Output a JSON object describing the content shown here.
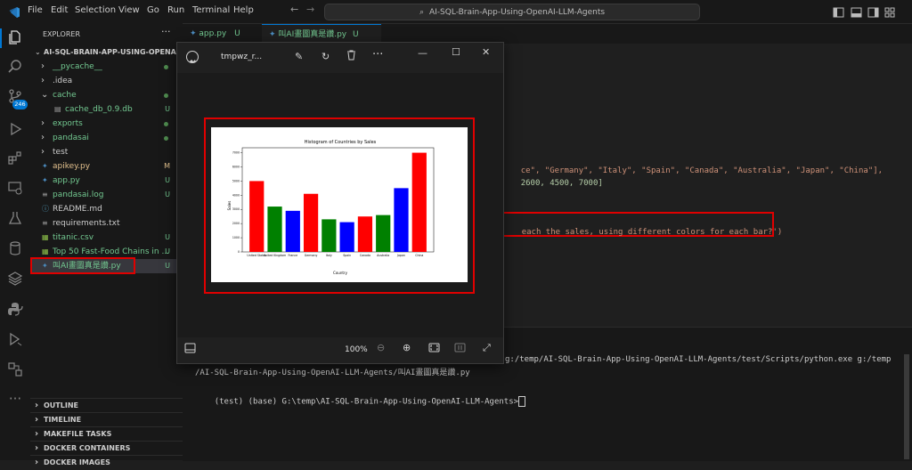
{
  "menu": [
    "File",
    "Edit",
    "Selection",
    "View",
    "Go",
    "Run",
    "Terminal",
    "Help"
  ],
  "command_center": "AI-SQL-Brain-App-Using-OpenAI-LLM-Agents",
  "activity_badge": "246",
  "explorer": {
    "header": "EXPLORER",
    "root": "AI-SQL-BRAIN-APP-USING-OPENAI-LL...",
    "items": [
      {
        "label": "__pycache__",
        "kind": "folder",
        "open": false,
        "indent": 1,
        "color": "#73c991",
        "status": "",
        "dot": true
      },
      {
        "label": ".idea",
        "kind": "folder",
        "open": false,
        "indent": 1,
        "color": "#cccccc",
        "status": "",
        "dot": false
      },
      {
        "label": "cache",
        "kind": "folder",
        "open": true,
        "indent": 1,
        "color": "#73c991",
        "status": "",
        "dot": true
      },
      {
        "label": "cache_db_0.9.db",
        "kind": "file",
        "indent": 2,
        "color": "#73c991",
        "status": "U",
        "dot": false
      },
      {
        "label": "exports",
        "kind": "folder",
        "open": false,
        "indent": 1,
        "color": "#73c991",
        "status": "",
        "dot": true
      },
      {
        "label": "pandasai",
        "kind": "folder",
        "open": false,
        "indent": 1,
        "color": "#73c991",
        "status": "",
        "dot": true
      },
      {
        "label": "test",
        "kind": "folder",
        "open": false,
        "indent": 1,
        "color": "#cccccc",
        "status": "",
        "dot": false
      },
      {
        "label": "apikey.py",
        "kind": "py",
        "indent": 1,
        "color": "#e2c08d",
        "status": "M",
        "dot": false
      },
      {
        "label": "app.py",
        "kind": "py",
        "indent": 1,
        "color": "#73c991",
        "status": "U",
        "dot": false
      },
      {
        "label": "pandasai.log",
        "kind": "log",
        "indent": 1,
        "color": "#73c991",
        "status": "U",
        "dot": false
      },
      {
        "label": "README.md",
        "kind": "md",
        "indent": 1,
        "color": "#cccccc",
        "status": "",
        "dot": false
      },
      {
        "label": "requirements.txt",
        "kind": "txt",
        "indent": 1,
        "color": "#cccccc",
        "status": "",
        "dot": false
      },
      {
        "label": "titanic.csv",
        "kind": "csv",
        "indent": 1,
        "color": "#73c991",
        "status": "U",
        "dot": false
      },
      {
        "label": "Top 50 Fast-Food Chains in ...",
        "kind": "csv",
        "indent": 1,
        "color": "#73c991",
        "status": "U",
        "dot": false
      },
      {
        "label": "叫AI畫圖真是讚.py",
        "kind": "py",
        "indent": 1,
        "color": "#73c991",
        "status": "U",
        "dot": false
      }
    ],
    "sections": [
      "OUTLINE",
      "TIMELINE",
      "MAKEFILE TASKS",
      "DOCKER CONTAINERS",
      "DOCKER IMAGES"
    ]
  },
  "tabs": [
    {
      "label": "app.py",
      "status": "U",
      "active": false
    },
    {
      "label": "叫AI畫圖真是讚.py",
      "status": "U",
      "active": true
    }
  ],
  "editor": {
    "line1": "ce\", \"Germany\", \"Italy\", \"Spain\", \"Canada\", \"Australia\", \"Japan\", \"China\"],",
    "line2": "2600, 4500, 7000]",
    "line3": "each the sales, using different colors for each bar?')"
  },
  "terminal": {
    "line1": "g:/temp/AI-SQL-Brain-App-Using-OpenAI-LLM-Agents/test/Scripts/python.exe g:/temp",
    "line2": "/AI-SQL-Brain-App-Using-OpenAI-LLM-Agents/叫AI畫圖真是讚.py",
    "prompt": "(test) (base) G:\\temp\\AI-SQL-Brain-App-Using-OpenAI-LLM-Agents>"
  },
  "viewer": {
    "title": "tmpwz_r...",
    "zoom": "100%"
  },
  "chart_data": {
    "type": "bar",
    "title": "Histogram of Countries by Sales",
    "xlabel": "Country",
    "ylabel": "Sales",
    "categories": [
      "United States",
      "United Kingdom",
      "France",
      "Germany",
      "Italy",
      "Spain",
      "Canada",
      "Australia",
      "Japan",
      "China"
    ],
    "values": [
      5000,
      3200,
      2900,
      4100,
      2300,
      2100,
      2500,
      2600,
      4500,
      7000
    ],
    "colors": [
      "#ff0000",
      "#008000",
      "#0000ff",
      "#ff0000",
      "#008000",
      "#0000ff",
      "#ff0000",
      "#008000",
      "#0000ff",
      "#ff0000"
    ],
    "yticks": [
      0,
      1000,
      2000,
      3000,
      4000,
      5000,
      6000,
      7000
    ],
    "ylim": [
      0,
      7350
    ],
    "grid": false
  }
}
